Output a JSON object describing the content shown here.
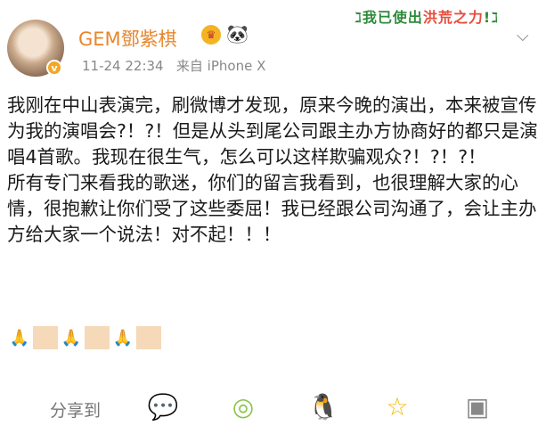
{
  "header": {
    "username": "GEM鄧紫棋",
    "badge_v": "v",
    "timestamp": "11-24 22:34",
    "source": "来自 iPhone X",
    "banner_prefix": "ℷ我已使出",
    "banner_highlight": "洪荒之力",
    "banner_suffix": "!ℷ"
  },
  "post": {
    "paragraph1": "我刚在中山表演完，刷微博才发现，原来今晚的演出，本来被宣传为我的演唱会?！?！但是从头到尾公司跟主办方协商好的都只是演唱4首歌。我现在很生气，怎么可以这样欺骗观众?！?！?！",
    "paragraph2": "所有专门来看我的歌迷，你们的留言我看到，也很理解大家的心情，很抱歉让你们受了这些委屈！我已经跟公司沟通了，会让主办方给大家一个说法！对不起！！！"
  },
  "emojis": {
    "pray": "🙏"
  },
  "share": {
    "label": "分享到",
    "wechat_icon": "wechat-icon",
    "moments_icon": "moments-icon",
    "qq_icon": "qq-icon",
    "qzone_icon": "qzone-icon",
    "more_icon": "more-icon"
  }
}
